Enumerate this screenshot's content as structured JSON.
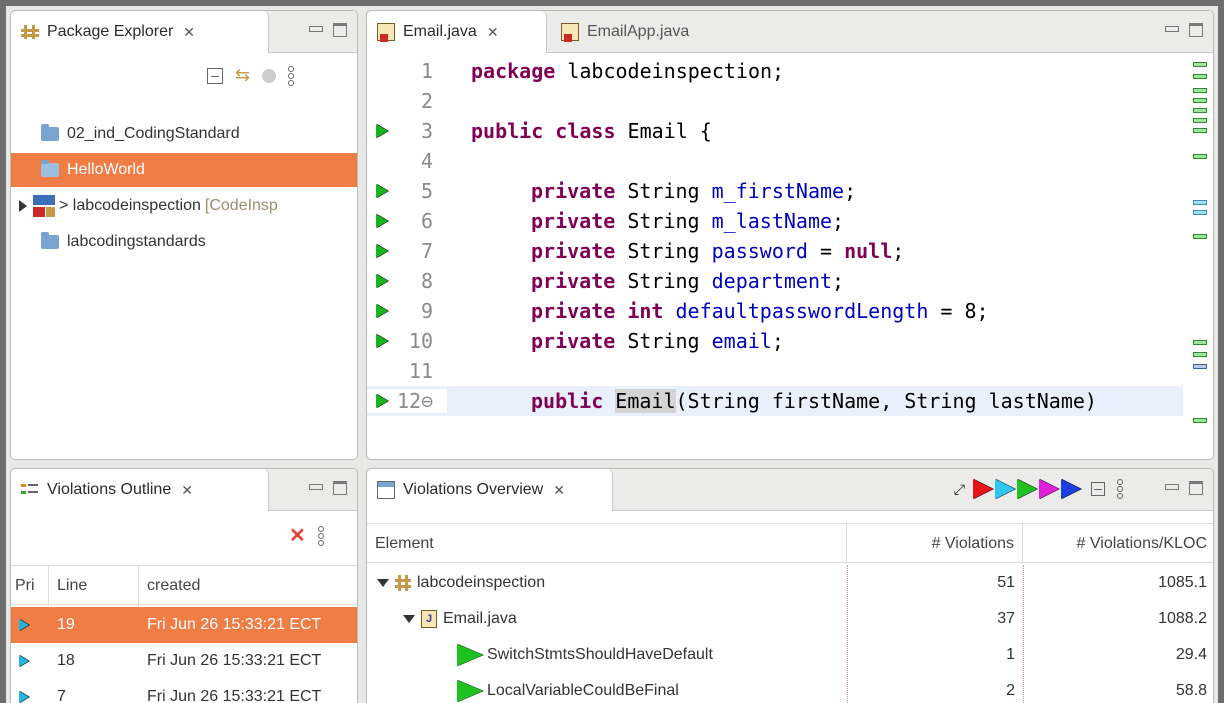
{
  "package_explorer": {
    "tab_label": "Package Explorer",
    "items": [
      {
        "label": "02_ind_CodingStandard",
        "suffix": ""
      },
      {
        "label": "HelloWorld",
        "suffix": ""
      },
      {
        "label": "> labcodeinspection",
        "suffix": "[CodeInsp"
      },
      {
        "label": "labcodingstandards",
        "suffix": ""
      }
    ]
  },
  "editor": {
    "tabs": [
      {
        "label": "Email.java"
      },
      {
        "label": "EmailApp.java"
      }
    ],
    "lines": [
      {
        "num": "1",
        "marker": false
      },
      {
        "num": "2",
        "marker": false
      },
      {
        "num": "3",
        "marker": true
      },
      {
        "num": "4",
        "marker": false
      },
      {
        "num": "5",
        "marker": true
      },
      {
        "num": "6",
        "marker": true
      },
      {
        "num": "7",
        "marker": true
      },
      {
        "num": "8",
        "marker": true
      },
      {
        "num": "9",
        "marker": true
      },
      {
        "num": "10",
        "marker": true
      },
      {
        "num": "11",
        "marker": false
      },
      {
        "num": "12⊖",
        "marker": true
      }
    ],
    "code": {
      "l1_kw": "package",
      "l1_rest": " labcodeinspection;",
      "l3_kw": "public class",
      "l3_rest": " Email {",
      "l5_kw": "private",
      "l5_type": " String ",
      "l5_field": "m_firstName",
      "l5_end": ";",
      "l6_kw": "private",
      "l6_type": " String ",
      "l6_field": "m_lastName",
      "l6_end": ";",
      "l7_kw": "private",
      "l7_type": " String ",
      "l7_field": "password",
      "l7_mid": " = ",
      "l7_kw2": "null",
      "l7_end": ";",
      "l8_kw": "private",
      "l8_type": " String ",
      "l8_field": "department",
      "l8_end": ";",
      "l9_kw": "private int",
      "l9_field": " defaultpasswordLength",
      "l9_end": " = 8;",
      "l10_kw": "private",
      "l10_type": " String ",
      "l10_field": "email",
      "l10_end": ";",
      "l12_kw": "public",
      "l12_sp": " ",
      "l12_ctor": "Email",
      "l12_rest": "(String firstName, String lastName)"
    }
  },
  "violations_outline": {
    "tab_label": "Violations Outline",
    "columns": [
      "Pri",
      "Line",
      "created"
    ],
    "rows": [
      {
        "line": "19",
        "created": "Fri Jun 26 15:33:21 ECT"
      },
      {
        "line": "18",
        "created": "Fri Jun 26 15:33:21 ECT"
      },
      {
        "line": "7",
        "created": "Fri Jun 26 15:33:21 ECT"
      }
    ]
  },
  "violations_overview": {
    "tab_label": "Violations Overview",
    "columns": [
      "Element",
      "# Violations",
      "# Violations/KLOC"
    ],
    "rows": [
      {
        "name": "labcodeinspection",
        "violations": "51",
        "kloc": "1085.1"
      },
      {
        "name": "Email.java",
        "violations": "37",
        "kloc": "1088.2"
      },
      {
        "name": "SwitchStmtsShouldHaveDefault",
        "violations": "1",
        "kloc": "29.4"
      },
      {
        "name": "LocalVariableCouldBeFinal",
        "violations": "2",
        "kloc": "58.8"
      }
    ],
    "filter_colors": [
      "#e8141b",
      "#2fc7ef",
      "#22c022",
      "#e020d8",
      "#1c3fe0"
    ]
  },
  "colors": {
    "selection": "#f07c46",
    "keyword": "#7f0055",
    "field": "#0000c0"
  }
}
